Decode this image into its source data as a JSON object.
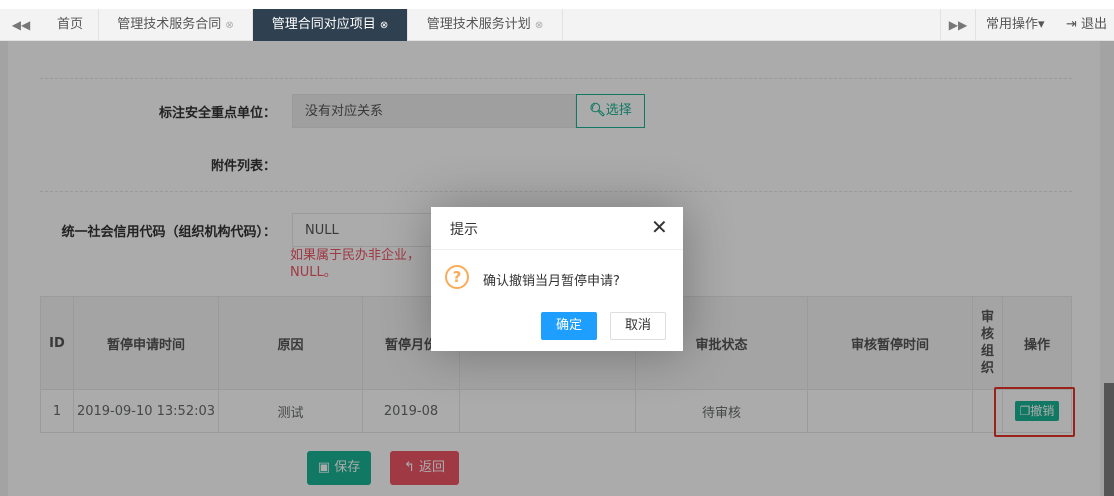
{
  "tabs": {
    "items": [
      {
        "label": "首页"
      },
      {
        "label": "管理技术服务合同",
        "closable": true
      },
      {
        "label": "管理合同对应项目",
        "closable": true,
        "active": true
      },
      {
        "label": "管理技术服务计划",
        "closable": true
      }
    ],
    "close_glyph": "⊗",
    "common_ops": "常用操作▾",
    "logout": "退出"
  },
  "form": {
    "key_unit_label": "标注安全重点单位：",
    "key_unit_value": "没有对应关系",
    "select_button": "选择",
    "attachments_label": "附件列表：",
    "credit_code_label": "统一社会信用代码（组织机构代码）：",
    "credit_code_value": "NULL",
    "credit_code_hint_line1": "如果属于民办非企业，",
    "credit_code_hint_line2": "NULL。"
  },
  "table": {
    "headers": [
      "ID",
      "暂停申请时间",
      "原因",
      "暂停月份",
      "",
      "审批状态",
      "审核暂停时间",
      "审核组织",
      "操作"
    ],
    "header_org_chars": [
      "审",
      "核",
      "组",
      "织"
    ],
    "rows": [
      {
        "id": "1",
        "time": "2019-09-10 13:52:03",
        "reason": "测试",
        "month": "2019-08",
        "blank": "",
        "status": "待审核",
        "audit_time": "",
        "audit_org": "",
        "action": "撤销"
      }
    ]
  },
  "buttons": {
    "save": "保存",
    "back": "返回"
  },
  "dialog": {
    "title": "提示",
    "message": "确认撤销当月暂停申请?",
    "ok": "确定",
    "cancel": "取消"
  },
  "colors": {
    "primary": "#1ab394",
    "danger": "#ed5565",
    "dialog_ok": "#1e9fff",
    "warning": "#f8ac59",
    "active_tab": "#2f4050",
    "highlight_box": "#e8332b"
  }
}
